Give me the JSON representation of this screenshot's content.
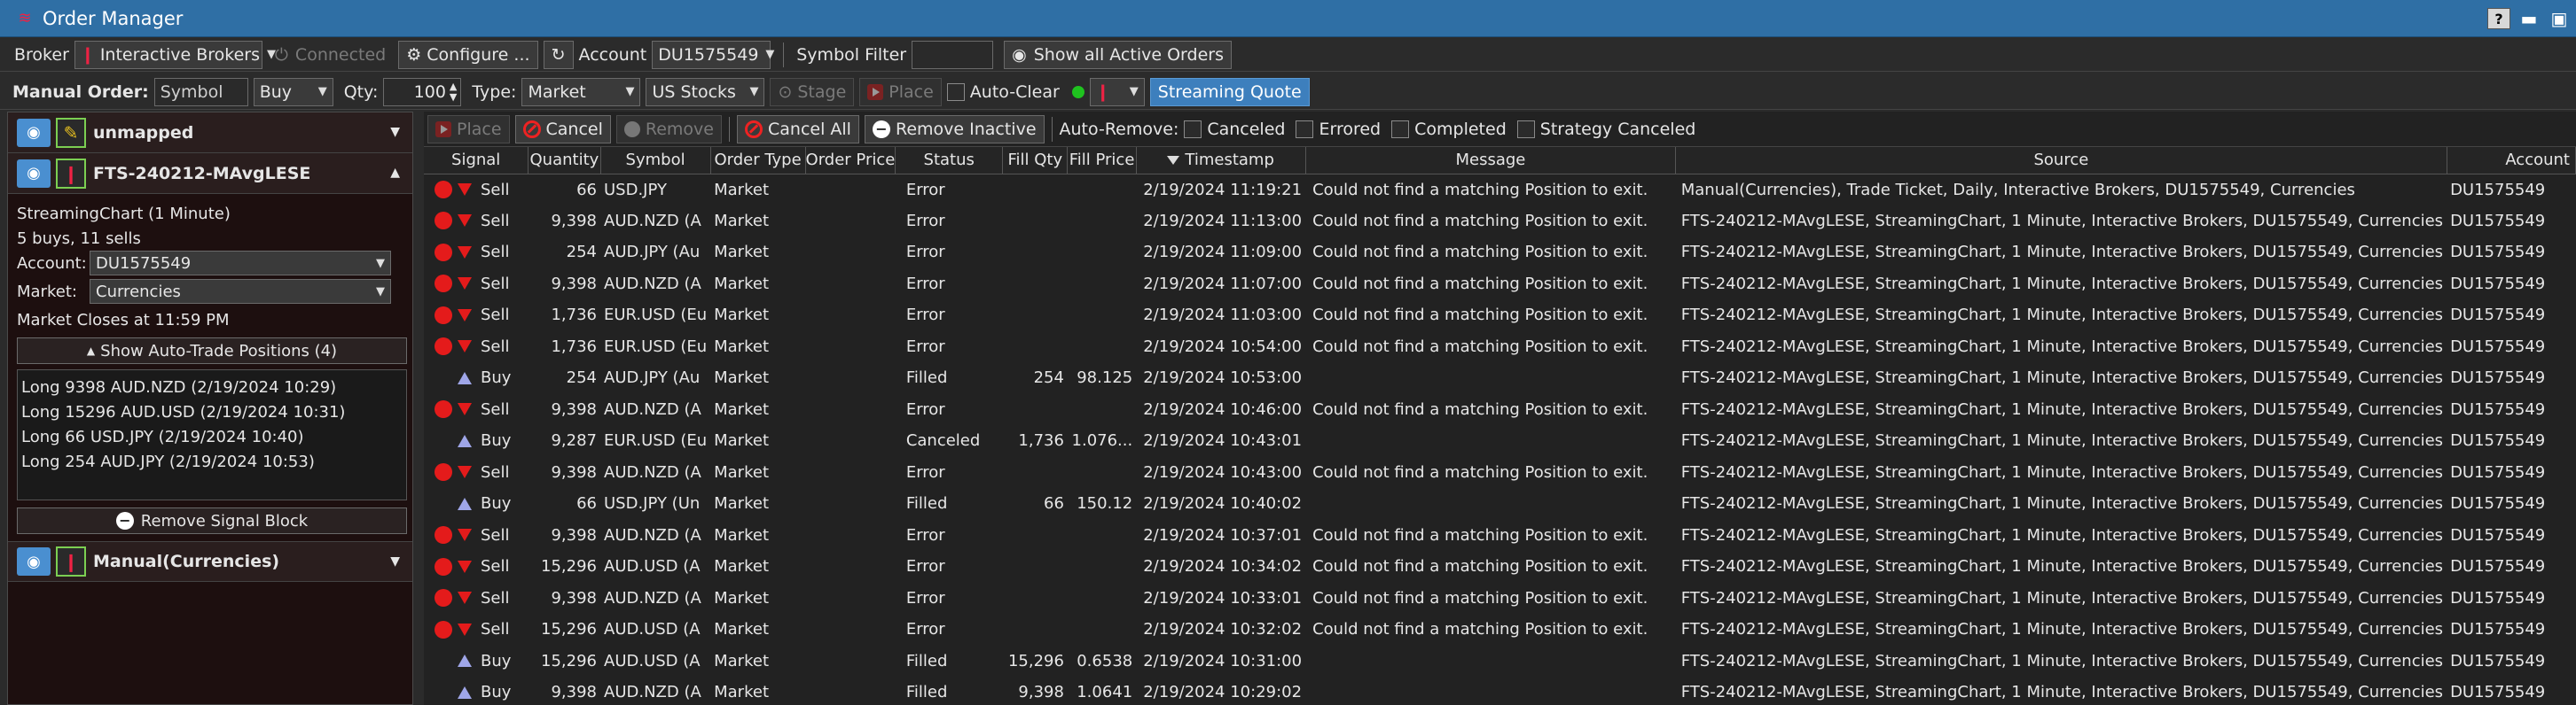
{
  "window": {
    "title": "Order Manager",
    "btn_help": "?",
    "btn_min": "▬",
    "btn_max": "▣"
  },
  "toolbar1": {
    "broker_label": "Broker",
    "broker_value": "Interactive Brokers",
    "connected": "Connected",
    "configure": "Configure ...",
    "account_label": "Account",
    "account_value": "DU1575549",
    "symbol_filter_label": "Symbol Filter",
    "symbol_filter_value": "",
    "show_all": "Show all Active Orders"
  },
  "toolbar2": {
    "manual_order_label": "Manual Order:",
    "symbol_placeholder": "Symbol",
    "side": "Buy",
    "qty_label": "Qty:",
    "qty": "100",
    "type_label": "Type:",
    "type_value": "Market",
    "market_value": "US Stocks",
    "stage": "Stage",
    "place": "Place",
    "auto_clear": "Auto-Clear",
    "streaming_quote": "Streaming Quote"
  },
  "left": {
    "groups": [
      {
        "name": "unmapped"
      },
      {
        "name": "FTS-240212-MAvgLESE"
      },
      {
        "name": "Manual(Currencies)"
      }
    ],
    "detail": {
      "chart": "StreamingChart (1 Minute)",
      "counts": "5 buys, 11 sells",
      "account_label": "Account:",
      "account_value": "DU1575549",
      "market_label": "Market:",
      "market_value": "Currencies",
      "closes": "Market Closes at 11:59 PM",
      "show_positions": "Show Auto-Trade Positions (4)",
      "positions": [
        "Long 9398 AUD.NZD (2/19/2024 10:29)",
        "Long 15296 AUD.USD (2/19/2024 10:31)",
        "Long 66 USD.JPY (2/19/2024 10:40)",
        "Long 254 AUD.JPY (2/19/2024 10:53)"
      ],
      "remove_block": "Remove Signal Block"
    }
  },
  "actions": {
    "place": "Place",
    "cancel": "Cancel",
    "remove": "Remove",
    "cancel_all": "Cancel All",
    "remove_inactive": "Remove Inactive",
    "auto_remove": "Auto-Remove:",
    "canceled": "Canceled",
    "errored": "Errored",
    "completed": "Completed",
    "strategy_canceled": "Strategy Canceled"
  },
  "columns": [
    "Signal",
    "Quantity",
    "Symbol",
    "Order Type",
    "Order Price",
    "Status",
    "Fill Qty",
    "Fill Price",
    "Timestamp",
    "Message",
    "Source",
    "Account"
  ],
  "rows": [
    {
      "side": "Sell",
      "qty": "66",
      "symbol": "USD.JPY",
      "type": "Market",
      "price": "",
      "status": "Error",
      "fill_qty": "",
      "fill_price": "",
      "ts": "2/19/2024 11:19:21",
      "msg": "Could not find a matching Position to exit.",
      "source": "Manual(Currencies), Trade Ticket, Daily, Interactive Brokers, DU1575549, Currencies",
      "account": "DU1575549"
    },
    {
      "side": "Sell",
      "qty": "9,398",
      "symbol": "AUD.NZD (A",
      "type": "Market",
      "price": "",
      "status": "Error",
      "fill_qty": "",
      "fill_price": "",
      "ts": "2/19/2024 11:13:00",
      "msg": "Could not find a matching Position to exit.",
      "source": "FTS-240212-MAvgLESE, StreamingChart, 1 Minute, Interactive Brokers, DU1575549, Currencies",
      "account": "DU1575549"
    },
    {
      "side": "Sell",
      "qty": "254",
      "symbol": "AUD.JPY (Au",
      "type": "Market",
      "price": "",
      "status": "Error",
      "fill_qty": "",
      "fill_price": "",
      "ts": "2/19/2024 11:09:00",
      "msg": "Could not find a matching Position to exit.",
      "source": "FTS-240212-MAvgLESE, StreamingChart, 1 Minute, Interactive Brokers, DU1575549, Currencies",
      "account": "DU1575549"
    },
    {
      "side": "Sell",
      "qty": "9,398",
      "symbol": "AUD.NZD (A",
      "type": "Market",
      "price": "",
      "status": "Error",
      "fill_qty": "",
      "fill_price": "",
      "ts": "2/19/2024 11:07:00",
      "msg": "Could not find a matching Position to exit.",
      "source": "FTS-240212-MAvgLESE, StreamingChart, 1 Minute, Interactive Brokers, DU1575549, Currencies",
      "account": "DU1575549"
    },
    {
      "side": "Sell",
      "qty": "1,736",
      "symbol": "EUR.USD (Eu",
      "type": "Market",
      "price": "",
      "status": "Error",
      "fill_qty": "",
      "fill_price": "",
      "ts": "2/19/2024 11:03:00",
      "msg": "Could not find a matching Position to exit.",
      "source": "FTS-240212-MAvgLESE, StreamingChart, 1 Minute, Interactive Brokers, DU1575549, Currencies",
      "account": "DU1575549"
    },
    {
      "side": "Sell",
      "qty": "1,736",
      "symbol": "EUR.USD (Eu",
      "type": "Market",
      "price": "",
      "status": "Error",
      "fill_qty": "",
      "fill_price": "",
      "ts": "2/19/2024 10:54:00",
      "msg": "Could not find a matching Position to exit.",
      "source": "FTS-240212-MAvgLESE, StreamingChart, 1 Minute, Interactive Brokers, DU1575549, Currencies",
      "account": "DU1575549"
    },
    {
      "side": "Buy",
      "qty": "254",
      "symbol": "AUD.JPY (Au",
      "type": "Market",
      "price": "",
      "status": "Filled",
      "fill_qty": "254",
      "fill_price": "98.125",
      "ts": "2/19/2024 10:53:00",
      "msg": "",
      "source": "FTS-240212-MAvgLESE, StreamingChart, 1 Minute, Interactive Brokers, DU1575549, Currencies",
      "account": "DU1575549"
    },
    {
      "side": "Sell",
      "qty": "9,398",
      "symbol": "AUD.NZD (A",
      "type": "Market",
      "price": "",
      "status": "Error",
      "fill_qty": "",
      "fill_price": "",
      "ts": "2/19/2024 10:46:00",
      "msg": "Could not find a matching Position to exit.",
      "source": "FTS-240212-MAvgLESE, StreamingChart, 1 Minute, Interactive Brokers, DU1575549, Currencies",
      "account": "DU1575549"
    },
    {
      "side": "Buy",
      "qty": "9,287",
      "symbol": "EUR.USD (Eu",
      "type": "Market",
      "price": "",
      "status": "Canceled",
      "fill_qty": "1,736",
      "fill_price": "1.076...",
      "ts": "2/19/2024 10:43:01",
      "msg": "",
      "source": "FTS-240212-MAvgLESE, StreamingChart, 1 Minute, Interactive Brokers, DU1575549, Currencies",
      "account": "DU1575549"
    },
    {
      "side": "Sell",
      "qty": "9,398",
      "symbol": "AUD.NZD (A",
      "type": "Market",
      "price": "",
      "status": "Error",
      "fill_qty": "",
      "fill_price": "",
      "ts": "2/19/2024 10:43:00",
      "msg": "Could not find a matching Position to exit.",
      "source": "FTS-240212-MAvgLESE, StreamingChart, 1 Minute, Interactive Brokers, DU1575549, Currencies",
      "account": "DU1575549"
    },
    {
      "side": "Buy",
      "qty": "66",
      "symbol": "USD.JPY (Un",
      "type": "Market",
      "price": "",
      "status": "Filled",
      "fill_qty": "66",
      "fill_price": "150.12",
      "ts": "2/19/2024 10:40:02",
      "msg": "",
      "source": "FTS-240212-MAvgLESE, StreamingChart, 1 Minute, Interactive Brokers, DU1575549, Currencies",
      "account": "DU1575549"
    },
    {
      "side": "Sell",
      "qty": "9,398",
      "symbol": "AUD.NZD (A",
      "type": "Market",
      "price": "",
      "status": "Error",
      "fill_qty": "",
      "fill_price": "",
      "ts": "2/19/2024 10:37:01",
      "msg": "Could not find a matching Position to exit.",
      "source": "FTS-240212-MAvgLESE, StreamingChart, 1 Minute, Interactive Brokers, DU1575549, Currencies",
      "account": "DU1575549"
    },
    {
      "side": "Sell",
      "qty": "15,296",
      "symbol": "AUD.USD (A",
      "type": "Market",
      "price": "",
      "status": "Error",
      "fill_qty": "",
      "fill_price": "",
      "ts": "2/19/2024 10:34:02",
      "msg": "Could not find a matching Position to exit.",
      "source": "FTS-240212-MAvgLESE, StreamingChart, 1 Minute, Interactive Brokers, DU1575549, Currencies",
      "account": "DU1575549"
    },
    {
      "side": "Sell",
      "qty": "9,398",
      "symbol": "AUD.NZD (A",
      "type": "Market",
      "price": "",
      "status": "Error",
      "fill_qty": "",
      "fill_price": "",
      "ts": "2/19/2024 10:33:01",
      "msg": "Could not find a matching Position to exit.",
      "source": "FTS-240212-MAvgLESE, StreamingChart, 1 Minute, Interactive Brokers, DU1575549, Currencies",
      "account": "DU1575549"
    },
    {
      "side": "Sell",
      "qty": "15,296",
      "symbol": "AUD.USD (A",
      "type": "Market",
      "price": "",
      "status": "Error",
      "fill_qty": "",
      "fill_price": "",
      "ts": "2/19/2024 10:32:02",
      "msg": "Could not find a matching Position to exit.",
      "source": "FTS-240212-MAvgLESE, StreamingChart, 1 Minute, Interactive Brokers, DU1575549, Currencies",
      "account": "DU1575549"
    },
    {
      "side": "Buy",
      "qty": "15,296",
      "symbol": "AUD.USD (A",
      "type": "Market",
      "price": "",
      "status": "Filled",
      "fill_qty": "15,296",
      "fill_price": "0.6538",
      "ts": "2/19/2024 10:31:00",
      "msg": "",
      "source": "FTS-240212-MAvgLESE, StreamingChart, 1 Minute, Interactive Brokers, DU1575549, Currencies",
      "account": "DU1575549"
    },
    {
      "side": "Buy",
      "qty": "9,398",
      "symbol": "AUD.NZD (A",
      "type": "Market",
      "price": "",
      "status": "Filled",
      "fill_qty": "9,398",
      "fill_price": "1.0641",
      "ts": "2/19/2024 10:29:02",
      "msg": "",
      "source": "FTS-240212-MAvgLESE, StreamingChart, 1 Minute, Interactive Brokers, DU1575549, Currencies",
      "account": "DU1575549"
    }
  ],
  "colors": {
    "accent": "#2f6fa5",
    "sell": "#e41b1b",
    "buy": "#9fa6e8",
    "stream": "#3d7fbd"
  }
}
